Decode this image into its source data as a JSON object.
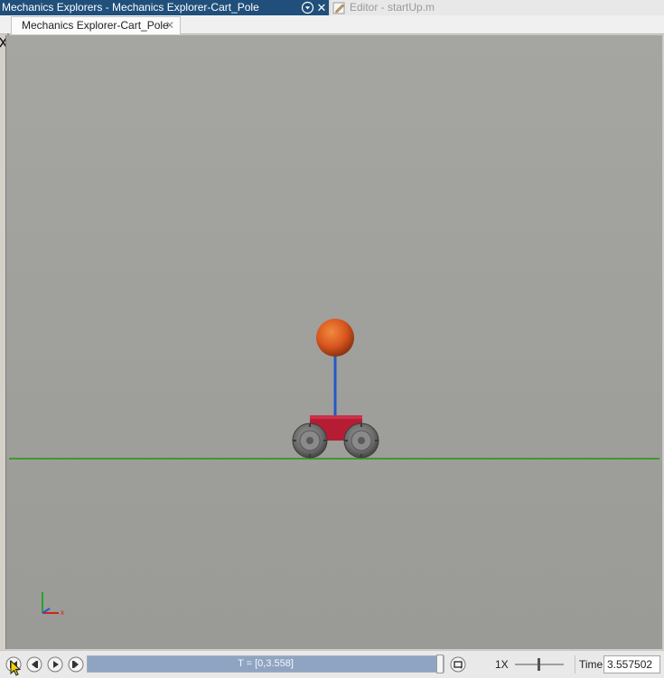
{
  "window": {
    "title": "Mechanics Explorers - Mechanics Explorer-Cart_Pole",
    "menu_icon": "dropdown-circle-icon",
    "close_label": "✕",
    "editor_tab_label": "Editor - startUp.m"
  },
  "document_tab": {
    "label": "Mechanics Explorer-Cart_Pole",
    "close_label": "✕"
  },
  "scene": {
    "objects": [
      "ground-line",
      "cart-body",
      "wheel-left",
      "wheel-right",
      "pole",
      "pole-mass-ball",
      "axes-triad"
    ],
    "colors": {
      "background": "#9d9d99",
      "ground": "#3c9a2c",
      "cart": "#b61d35",
      "pole": "#2458c8",
      "ball": "#d9561e",
      "wheels": "#6e6e6e"
    },
    "triad_x_label": "x"
  },
  "playback": {
    "buttons": [
      "skip-to-start",
      "step-back",
      "play",
      "step-forward"
    ],
    "progress_label": "T = [0,3.558]",
    "progress_fraction": 0.98,
    "rate_label": "1X",
    "time_label": "Time",
    "time_value": "3.557502"
  }
}
